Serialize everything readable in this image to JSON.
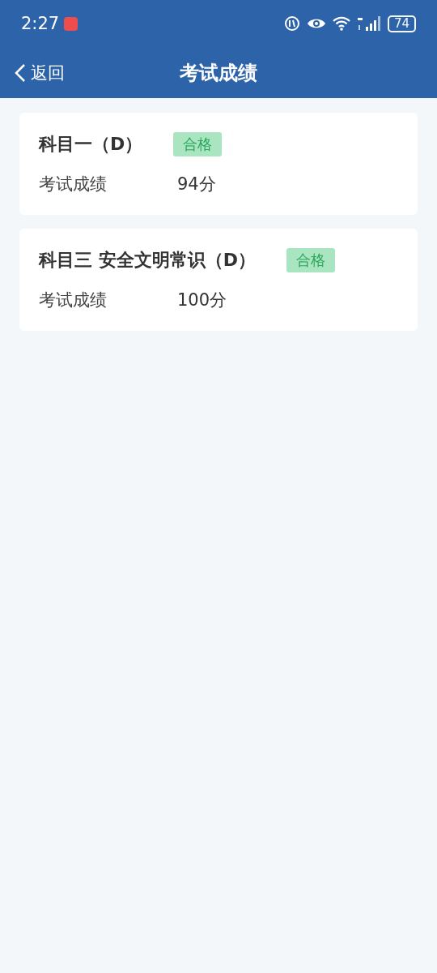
{
  "status_bar": {
    "time": "2:27",
    "battery": "74"
  },
  "header": {
    "back": "返回",
    "title": "考试成绩"
  },
  "results": [
    {
      "subject": "科目一（D）",
      "badge": "合格",
      "label": "考试成绩",
      "score": "94分"
    },
    {
      "subject": "科目三 安全文明常识（D）",
      "badge": "合格",
      "label": "考试成绩",
      "score": "100分"
    }
  ]
}
